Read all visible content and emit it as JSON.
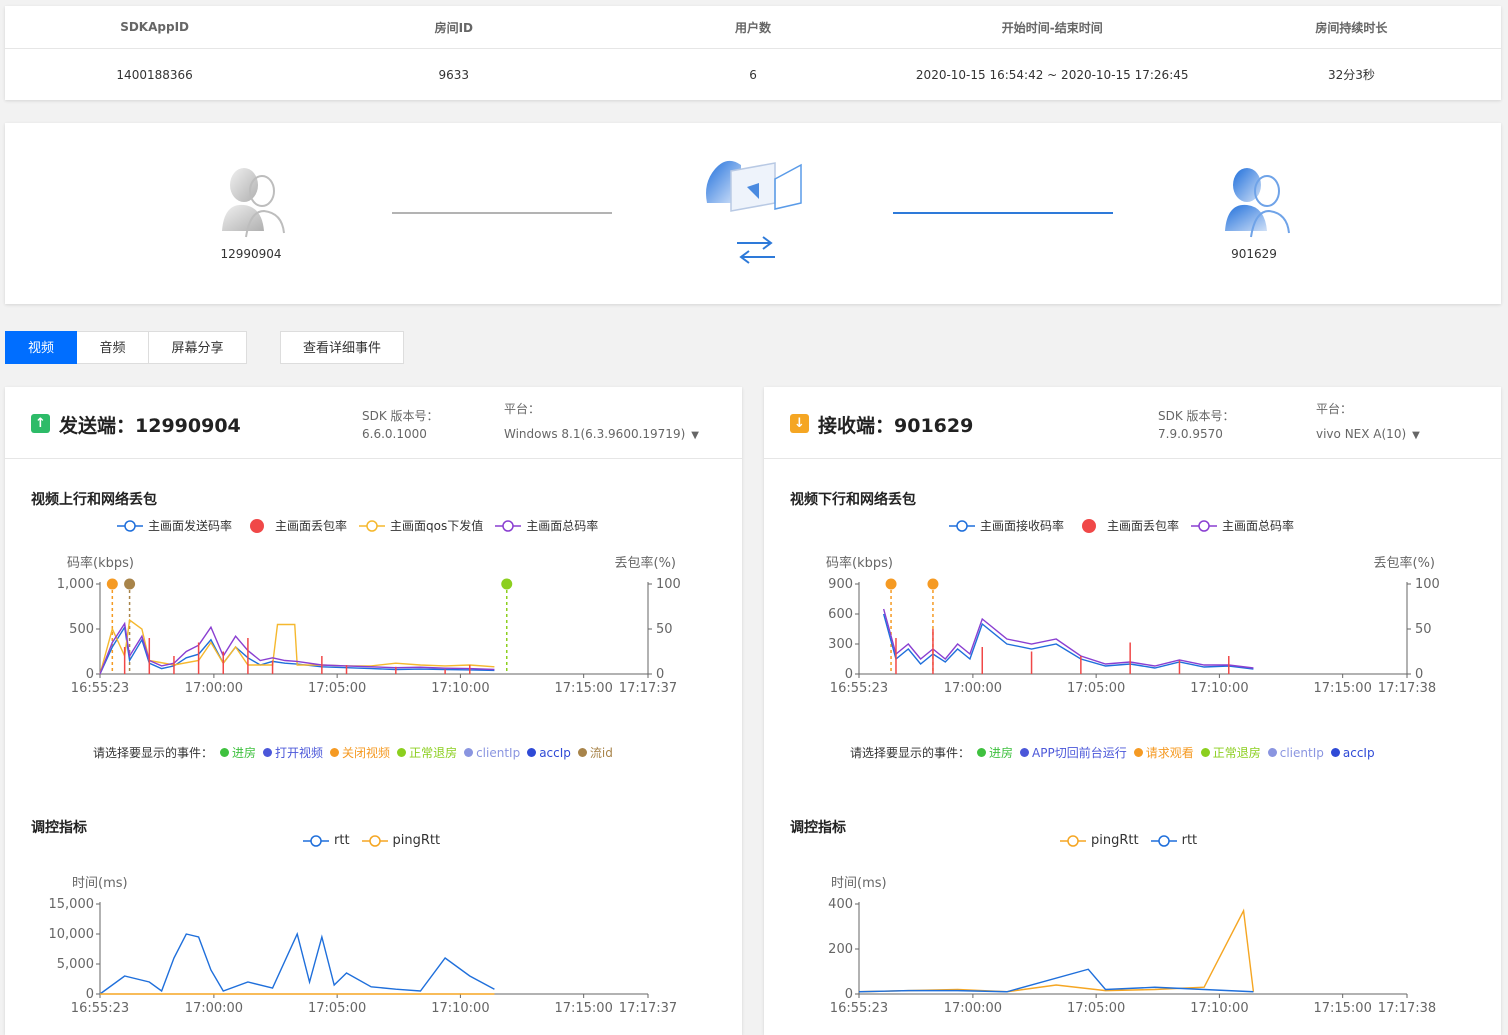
{
  "room_table": {
    "headers": [
      "SDKAppID",
      "房间ID",
      "用户数",
      "开始时间-结束时间",
      "房间持续时长"
    ],
    "row": [
      "1400188366",
      "9633",
      "6",
      "2020-10-15 16:54:42 ~ 2020-10-15 17:26:45",
      "32分3秒"
    ]
  },
  "topology": {
    "sender_id": "12990904",
    "receiver_id": "901629",
    "sender_link_color": "#b3b3b3",
    "receiver_link_color": "#2e7ad9"
  },
  "tabs": [
    "视频",
    "音频",
    "屏幕分享"
  ],
  "active_tab": "视频",
  "events_button": "查看详细事件",
  "colors": {
    "accent": "#006eff",
    "sender_icon": "#2dbb68",
    "receiver_icon": "#f5a623"
  },
  "sender": {
    "role_label": "发送端：",
    "user_id": "12990904",
    "icon": "arrow-up-icon",
    "sdk_label": "SDK 版本号：",
    "sdk_version": "6.6.0.1000",
    "platform_label": "平台：",
    "platform_value": "Windows 8.1(6.3.9600.19719)",
    "bitrate_title": "视频上行和网络丢包",
    "legend": [
      {
        "label": "主画面发送码率",
        "color": "#1f6fdb",
        "style": "hollow"
      },
      {
        "label": "主画面丢包率",
        "color": "#f04848",
        "style": "filled"
      },
      {
        "label": "主画面qos下发值",
        "color": "#f5b82e",
        "style": "hollow"
      },
      {
        "label": "主画面总码率",
        "color": "#8a3fd1",
        "style": "hollow"
      }
    ],
    "events_label": "请选择要显示的事件：",
    "events": [
      {
        "label": "进房",
        "color": "#3fc13f"
      },
      {
        "label": "打开视频",
        "color": "#4b57d9"
      },
      {
        "label": "关闭视频",
        "color": "#f59a23"
      },
      {
        "label": "正常退房",
        "color": "#8ccf1f"
      },
      {
        "label": "clientIp",
        "color": "#8a95e0"
      },
      {
        "label": "accIp",
        "color": "#2f4ad6"
      },
      {
        "label": "流id",
        "color": "#a8844a"
      }
    ],
    "control_title": "调控指标",
    "control_legend": [
      {
        "label": "rtt",
        "color": "#1f6fdb"
      },
      {
        "label": "pingRtt",
        "color": "#f5a623"
      }
    ]
  },
  "receiver": {
    "role_label": "接收端：",
    "user_id": "901629",
    "icon": "arrow-down-icon",
    "sdk_label": "SDK 版本号：",
    "sdk_version": "7.9.0.9570",
    "platform_label": "平台：",
    "platform_value": "vivo NEX A(10)",
    "bitrate_title": "视频下行和网络丢包",
    "legend": [
      {
        "label": "主画面接收码率",
        "color": "#1f6fdb",
        "style": "hollow"
      },
      {
        "label": "主画面丢包率",
        "color": "#f04848",
        "style": "filled"
      },
      {
        "label": "主画面总码率",
        "color": "#8a3fd1",
        "style": "hollow"
      }
    ],
    "events_label": "请选择要显示的事件：",
    "events": [
      {
        "label": "进房",
        "color": "#3fc13f"
      },
      {
        "label": "APP切回前台运行",
        "color": "#4b57d9"
      },
      {
        "label": "请求观看",
        "color": "#f59a23"
      },
      {
        "label": "正常退房",
        "color": "#8ccf1f"
      },
      {
        "label": "clientIp",
        "color": "#8a95e0"
      },
      {
        "label": "accIp",
        "color": "#2f4ad6"
      }
    ],
    "control_title": "调控指标",
    "control_legend": [
      {
        "label": "pingRtt",
        "color": "#f5a623"
      },
      {
        "label": "rtt",
        "color": "#1f6fdb"
      }
    ]
  },
  "chart_data": [
    {
      "type": "line",
      "title": "视频上行和网络丢包",
      "ylabel": "码率(kbps)",
      "y2label": "丢包率(%)",
      "ylim": [
        0,
        1000
      ],
      "yticks": [
        "1,000",
        "500",
        "0"
      ],
      "y2lim": [
        0,
        100
      ],
      "y2ticks": [
        "100",
        "50",
        "0"
      ],
      "xticks": [
        "16:55:23",
        "17:00:00",
        "17:05:00",
        "17:10:00",
        "17:15:00",
        "17:17:37"
      ],
      "series": [
        {
          "name": "主画面发送码率",
          "color": "#1f6fdb",
          "x_minutes": [
            0,
            0.5,
            1,
            1.2,
            1.7,
            2,
            2.5,
            3,
            3.5,
            4,
            4.5,
            5,
            5.5,
            6,
            6.5,
            7,
            7.5,
            8,
            9,
            10,
            11,
            12,
            13,
            14,
            15,
            16
          ],
          "values": [
            0,
            300,
            520,
            150,
            380,
            120,
            60,
            90,
            180,
            220,
            380,
            120,
            300,
            180,
            100,
            140,
            120,
            110,
            80,
            70,
            60,
            50,
            55,
            50,
            45,
            40
          ]
        },
        {
          "name": "主画面qos下发值",
          "color": "#f5b82e",
          "x_minutes": [
            0,
            0.5,
            1,
            1.2,
            1.7,
            2,
            3,
            4,
            4.5,
            5,
            5.5,
            6,
            7,
            7.2,
            7.9,
            8,
            9,
            10,
            11,
            12,
            13,
            14,
            15,
            16
          ],
          "values": [
            0,
            500,
            200,
            600,
            500,
            150,
            100,
            150,
            350,
            120,
            300,
            100,
            100,
            550,
            550,
            100,
            100,
            90,
            90,
            120,
            100,
            90,
            100,
            80
          ]
        },
        {
          "name": "主画面总码率",
          "color": "#8a3fd1",
          "x_minutes": [
            0,
            0.5,
            1,
            1.2,
            1.7,
            2,
            2.5,
            3,
            3.5,
            4,
            4.5,
            5,
            5.5,
            6,
            6.5,
            7,
            7.5,
            8,
            9,
            10,
            11,
            12,
            13,
            14,
            15,
            16
          ],
          "values": [
            0,
            350,
            560,
            200,
            420,
            150,
            90,
            120,
            250,
            320,
            520,
            200,
            420,
            260,
            150,
            180,
            150,
            140,
            100,
            90,
            80,
            70,
            75,
            65,
            60,
            50
          ]
        },
        {
          "name": "主画面丢包率",
          "color": "#f04848",
          "axis": "y2",
          "x_minutes": [
            1,
            2,
            3,
            4,
            5,
            6,
            7,
            9,
            10,
            12,
            14,
            15
          ],
          "values": [
            30,
            40,
            20,
            35,
            25,
            40,
            15,
            20,
            10,
            8,
            5,
            10
          ]
        }
      ],
      "event_markers": [
        {
          "x_minutes": 0.5,
          "color": "#f59a23"
        },
        {
          "x_minutes": 1.2,
          "color": "#a8844a"
        },
        {
          "x_minutes": 16.5,
          "color": "#8ccf1f"
        }
      ]
    },
    {
      "type": "line",
      "title": "视频下行和网络丢包",
      "ylabel": "码率(kbps)",
      "y2label": "丢包率(%)",
      "ylim": [
        0,
        900
      ],
      "yticks": [
        "900",
        "600",
        "300",
        "0"
      ],
      "y2lim": [
        0,
        100
      ],
      "y2ticks": [
        "100",
        "50",
        "0"
      ],
      "xticks": [
        "16:55:23",
        "17:00:00",
        "17:05:00",
        "17:10:00",
        "17:15:00",
        "17:17:38"
      ],
      "series": [
        {
          "name": "主画面接收码率",
          "color": "#1f6fdb",
          "x_minutes": [
            1,
            1.5,
            2,
            2.5,
            3,
            3.5,
            4,
            4.5,
            5,
            6,
            7,
            8,
            9,
            10,
            11,
            12,
            13,
            14,
            15,
            16
          ],
          "values": [
            600,
            150,
            250,
            100,
            200,
            120,
            250,
            150,
            500,
            300,
            250,
            300,
            150,
            80,
            100,
            60,
            120,
            70,
            80,
            50
          ]
        },
        {
          "name": "主画面总码率",
          "color": "#8a3fd1",
          "x_minutes": [
            1,
            1.5,
            2,
            2.5,
            3,
            3.5,
            4,
            4.5,
            5,
            6,
            7,
            8,
            9,
            10,
            11,
            12,
            13,
            14,
            15,
            16
          ],
          "values": [
            650,
            200,
            300,
            150,
            250,
            150,
            300,
            200,
            550,
            350,
            300,
            350,
            180,
            100,
            120,
            80,
            140,
            90,
            90,
            60
          ]
        },
        {
          "name": "主画面丢包率",
          "color": "#f04848",
          "axis": "y2",
          "x_minutes": [
            1.5,
            3,
            5,
            7,
            9,
            11,
            13,
            15
          ],
          "values": [
            40,
            50,
            30,
            25,
            20,
            35,
            15,
            20
          ]
        }
      ],
      "event_markers": [
        {
          "x_minutes": 1.3,
          "color": "#f59a23"
        },
        {
          "x_minutes": 3.0,
          "color": "#f59a23"
        }
      ]
    },
    {
      "type": "line",
      "title": "调控指标",
      "ylabel": "时间(ms)",
      "ylim": [
        0,
        15000
      ],
      "yticks": [
        "15,000",
        "10,000",
        "5,000",
        "0"
      ],
      "xticks": [
        "16:55:23",
        "17:00:00",
        "17:05:00",
        "17:10:00",
        "17:15:00",
        "17:17:37"
      ],
      "series": [
        {
          "name": "rtt",
          "color": "#1f6fdb",
          "x_minutes": [
            0,
            1,
            2,
            2.5,
            3,
            3.5,
            4,
            4.5,
            5,
            6,
            7,
            8,
            8.5,
            9,
            9.5,
            10,
            11,
            12,
            13,
            14,
            15,
            16
          ],
          "values": [
            0,
            3000,
            2000,
            500,
            6000,
            10000,
            9500,
            4000,
            500,
            2000,
            1000,
            10000,
            2000,
            9500,
            1500,
            3500,
            1200,
            800,
            500,
            6000,
            3000,
            800
          ]
        },
        {
          "name": "pingRtt",
          "color": "#f5a623",
          "x_minutes": [
            0,
            16
          ],
          "values": [
            0,
            0
          ]
        }
      ]
    },
    {
      "type": "line",
      "title": "调控指标",
      "ylabel": "时间(ms)",
      "ylim": [
        0,
        400
      ],
      "yticks": [
        "400",
        "200",
        "0"
      ],
      "xticks": [
        "16:55:23",
        "17:00:00",
        "17:05:00",
        "17:10:00",
        "17:15:00",
        "17:17:38"
      ],
      "series": [
        {
          "name": "pingRtt",
          "color": "#f5a623",
          "x_minutes": [
            0,
            2,
            4,
            6,
            8,
            10,
            12,
            14,
            15.6,
            16
          ],
          "values": [
            10,
            15,
            20,
            10,
            40,
            15,
            20,
            30,
            370,
            10
          ]
        },
        {
          "name": "rtt",
          "color": "#1f6fdb",
          "x_minutes": [
            0,
            2,
            4,
            6,
            9.3,
            10,
            12,
            14,
            16
          ],
          "values": [
            10,
            15,
            15,
            10,
            110,
            20,
            30,
            20,
            10
          ]
        }
      ]
    }
  ]
}
